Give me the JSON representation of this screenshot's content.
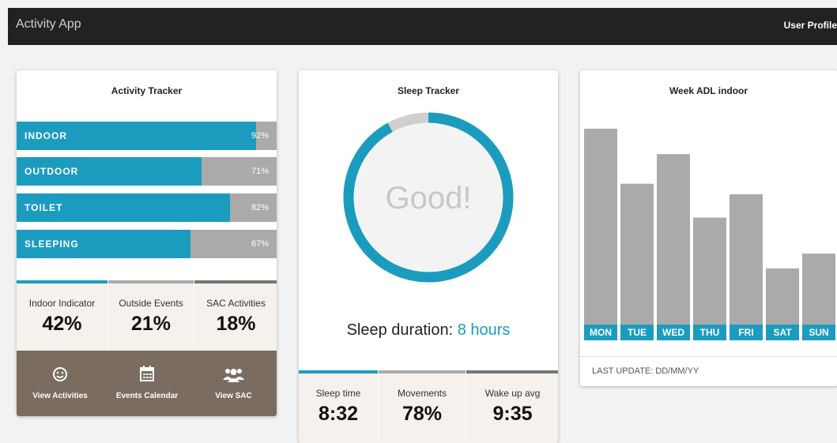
{
  "header": {
    "title": "Activity App",
    "user_profile": "User Profile"
  },
  "activity": {
    "title": "Activity Tracker",
    "bars": [
      {
        "label": "INDOOR",
        "percent_text": "92%",
        "value": 92
      },
      {
        "label": "OUTDOOR",
        "percent_text": "71%",
        "value": 71
      },
      {
        "label": "TOILET",
        "percent_text": "82%",
        "value": 82
      },
      {
        "label": "SLEEPING",
        "percent_text": "67%",
        "value": 67
      }
    ],
    "stats": [
      {
        "label": "Indoor Indicator",
        "value": "42%"
      },
      {
        "label": "Outside Events",
        "value": "21%"
      },
      {
        "label": "SAC Activities",
        "value": "18%"
      }
    ],
    "actions": [
      {
        "label": "View Activities",
        "icon": "smiley-icon"
      },
      {
        "label": "Events Calendar",
        "icon": "calendar-icon"
      },
      {
        "label": "View SAC",
        "icon": "users-icon"
      }
    ],
    "colors": {
      "accent": "#1b9cbf",
      "track": "#aaaaaa",
      "action_bg": "#7a6c60"
    }
  },
  "sleep": {
    "title": "Sleep Tracker",
    "gauge_text": "Good!",
    "gauge_value": 0.92,
    "duration_label": "Sleep duration:",
    "duration_value": "8 hours",
    "stats": [
      {
        "label": "Sleep time",
        "value": "8:32"
      },
      {
        "label": "Movements",
        "value": "78%"
      },
      {
        "label": "Wake up avg",
        "value": "9:35"
      }
    ]
  },
  "adl": {
    "title": "Week ADL indoor",
    "footer": "LAST UPDATE: DD/MM/YY"
  },
  "chart_data": {
    "type": "bar",
    "title": "Week ADL indoor",
    "categories": [
      "MON",
      "TUE",
      "WED",
      "THU",
      "FRI",
      "SAT",
      "SUN"
    ],
    "values": [
      100,
      74,
      88,
      58,
      69,
      34,
      41
    ],
    "ylim": [
      0,
      100
    ],
    "grid": false,
    "legend": "none"
  }
}
